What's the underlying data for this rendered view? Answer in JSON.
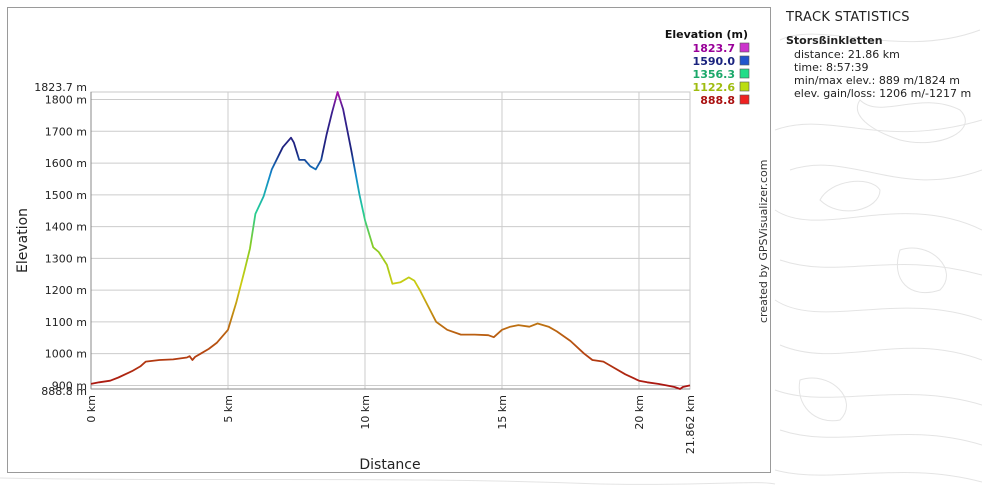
{
  "chart_data": {
    "type": "line",
    "xlabel": "Distance",
    "ylabel": "Elevation",
    "xlim": [
      0,
      21.862
    ],
    "ylim": [
      888.8,
      1823.7
    ],
    "x_ticks": [
      0,
      5,
      10,
      15,
      20
    ],
    "x_tick_labels": [
      "0 km",
      "5 km",
      "10 km",
      "15 km",
      "20 km"
    ],
    "x_end_label": "21.862 km",
    "y_ticks": [
      900,
      1000,
      1100,
      1200,
      1300,
      1400,
      1500,
      1600,
      1700,
      1800
    ],
    "y_tick_labels": [
      "900 m",
      "1000 m",
      "1100 m",
      "1200 m",
      "1300 m",
      "1400 m",
      "1500 m",
      "1600 m",
      "1700 m",
      "1800 m"
    ],
    "y_min_label": "888.8 m",
    "y_max_label": "1823.7 m",
    "grid": true,
    "series": [
      {
        "x": [
          0,
          0.3,
          0.7,
          1.0,
          1.5,
          1.8,
          2.0,
          2.5,
          3.0,
          3.5,
          3.6,
          3.7,
          3.8,
          4.0,
          4.3,
          4.6,
          5.0,
          5.3,
          5.6,
          5.8,
          6.0,
          6.3,
          6.6,
          7.0,
          7.3,
          7.4,
          7.6,
          7.8,
          8.0,
          8.2,
          8.4,
          8.6,
          8.8,
          9.0,
          9.2,
          9.5,
          9.8,
          10.0,
          10.3,
          10.5,
          10.8,
          11.0,
          11.3,
          11.6,
          11.8,
          12.0,
          12.3,
          12.6,
          13.0,
          13.5,
          14.0,
          14.5,
          14.7,
          15.0,
          15.3,
          15.6,
          16.0,
          16.3,
          16.7,
          17.0,
          17.5,
          18.0,
          18.3,
          18.7,
          19.0,
          19.5,
          20.0,
          20.3,
          20.7,
          21.0,
          21.3,
          21.5,
          21.6,
          21.862
        ],
        "y": [
          905,
          910,
          915,
          925,
          945,
          960,
          975,
          980,
          982,
          988,
          992,
          980,
          990,
          1000,
          1015,
          1035,
          1075,
          1160,
          1260,
          1330,
          1440,
          1495,
          1580,
          1650,
          1680,
          1665,
          1610,
          1610,
          1590,
          1580,
          1610,
          1690,
          1760,
          1823.7,
          1770,
          1640,
          1500,
          1420,
          1335,
          1320,
          1280,
          1220,
          1225,
          1240,
          1230,
          1200,
          1150,
          1100,
          1075,
          1060,
          1060,
          1058,
          1052,
          1075,
          1085,
          1090,
          1085,
          1095,
          1085,
          1070,
          1040,
          1000,
          980,
          975,
          960,
          935,
          915,
          910,
          905,
          900,
          895,
          888.8,
          895,
          900
        ]
      }
    ],
    "legend": {
      "title": "Elevation (m)",
      "placement": "top-right",
      "items": [
        {
          "label": "1823.7",
          "color": "#cc33cc",
          "text_color": "#990099"
        },
        {
          "label": "1590.0",
          "color": "#2255cc",
          "text_color": "#1a237e"
        },
        {
          "label": "1356.3",
          "color": "#22dd88",
          "text_color": "#1ba86a"
        },
        {
          "label": "1122.6",
          "color": "#bbdd11",
          "text_color": "#9fbc10"
        },
        {
          "label": "888.8",
          "color": "#ee2222",
          "text_color": "#aa1111"
        }
      ]
    },
    "credit": "created by GPSVisualizer.com"
  },
  "stats": {
    "title": "TRACK STATISTICS",
    "track_name": "Storsßinkletten",
    "lines": [
      "distance: 21.86 km",
      "time: 8:57:39",
      "min/max elev.: 889 m/1824 m",
      "elev. gain/loss: 1206 m/-1217 m"
    ]
  }
}
